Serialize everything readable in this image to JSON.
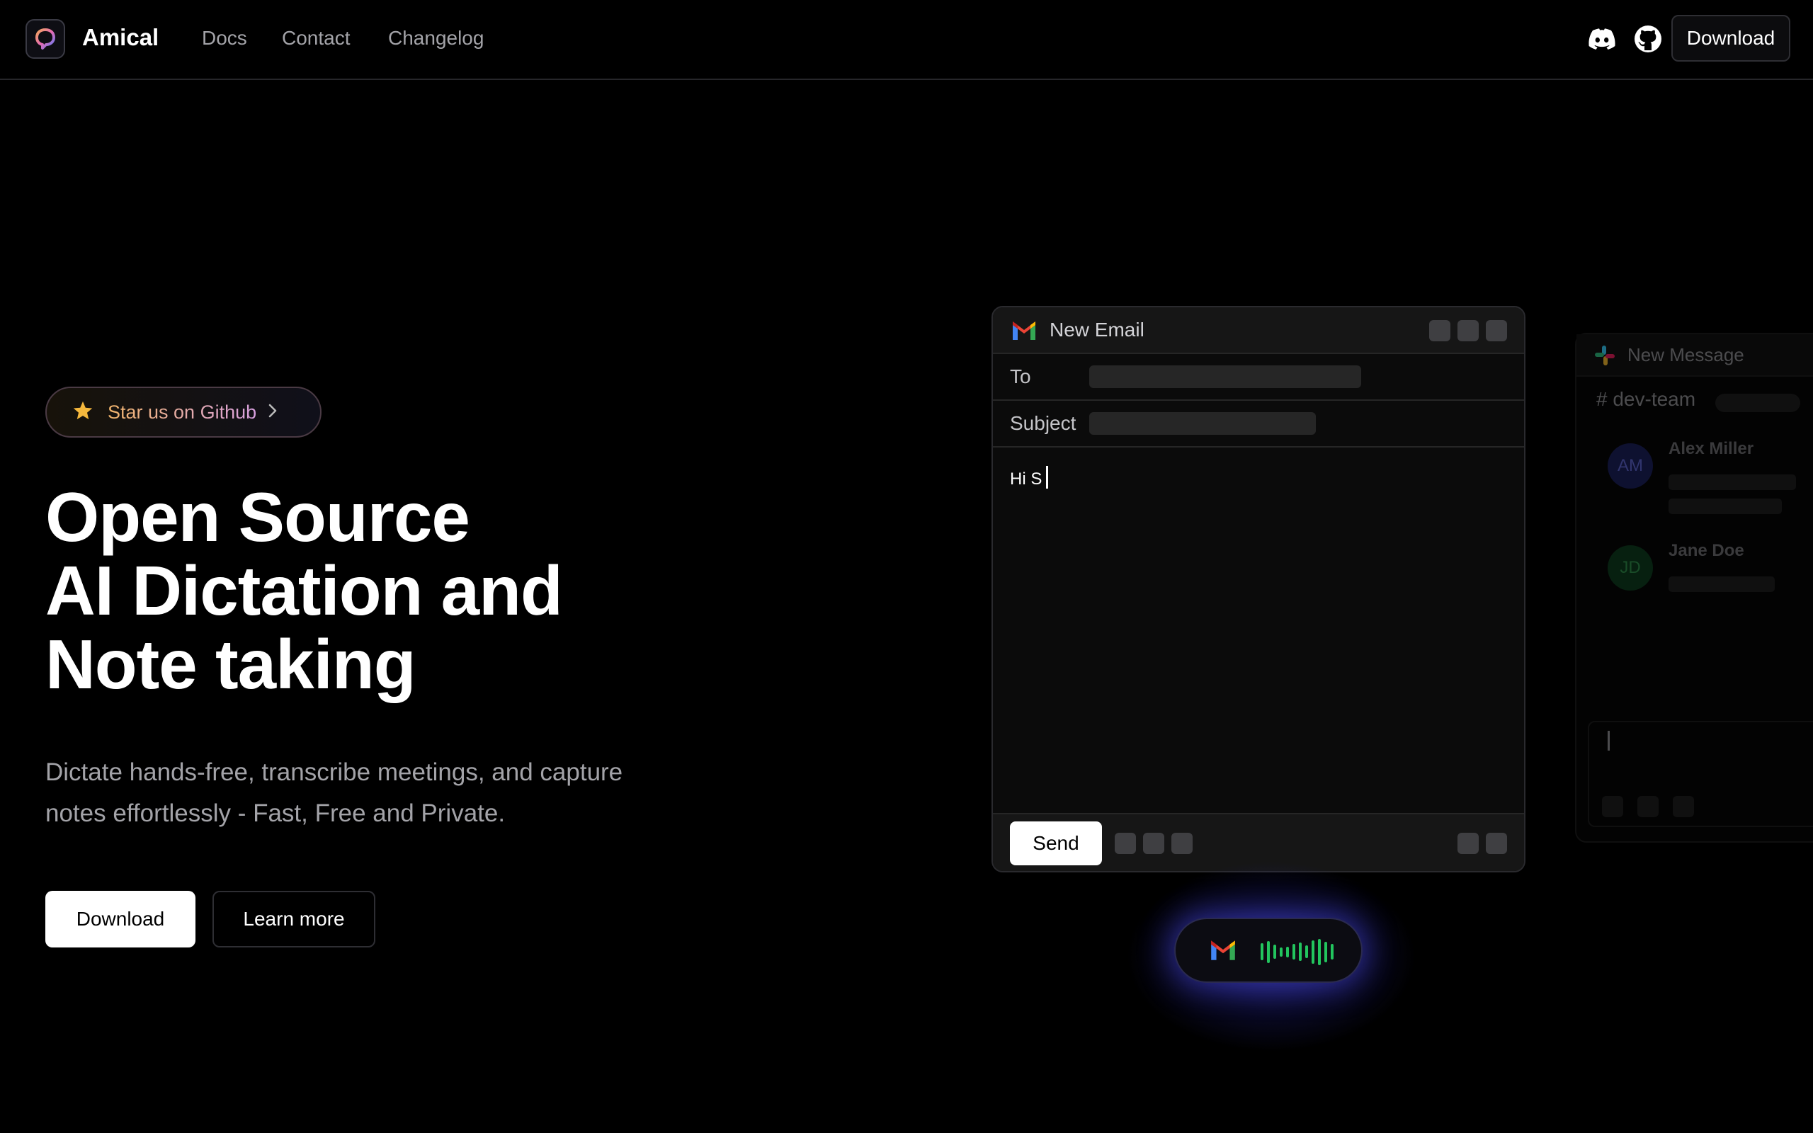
{
  "nav": {
    "brand": "Amical",
    "links": [
      "Docs",
      "Contact",
      "Changelog"
    ],
    "icons": [
      "discord-icon",
      "github-icon"
    ],
    "download_label": "Download"
  },
  "hero": {
    "badge_label": "Star us on Github",
    "headline": [
      "Open Source",
      "AI Dictation and",
      "Note taking"
    ],
    "subtitle_line1": "Dictate hands-free, transcribe meetings, and capture",
    "subtitle_line2": "notes effortlessly - Fast, Free and Private.",
    "download_label": "Download",
    "learn_more_label": "Learn more"
  },
  "email_window": {
    "title": "New Email",
    "to_label": "To",
    "subject_label": "Subject",
    "body_text": "Hi S",
    "send_label": "Send"
  },
  "slack_window": {
    "title": "New Message",
    "channel": "# dev-team",
    "messages": [
      {
        "initials": "AM",
        "name": "Alex Miller"
      },
      {
        "initials": "JD",
        "name": "Jane Doe"
      }
    ]
  },
  "recording_pill": {
    "app_icon": "gmail-icon",
    "wave_levels": [
      0.55,
      0.7,
      0.45,
      0.3,
      0.35,
      0.5,
      0.6,
      0.4,
      0.75,
      0.85,
      0.65,
      0.5
    ]
  },
  "colors": {
    "background": "#000000",
    "wave": "#22c55e",
    "glow": "#3c3cd2",
    "badge_gradient_start": "#f0b46a",
    "badge_gradient_end": "#d8a0e0",
    "star": "#f5b83d"
  }
}
